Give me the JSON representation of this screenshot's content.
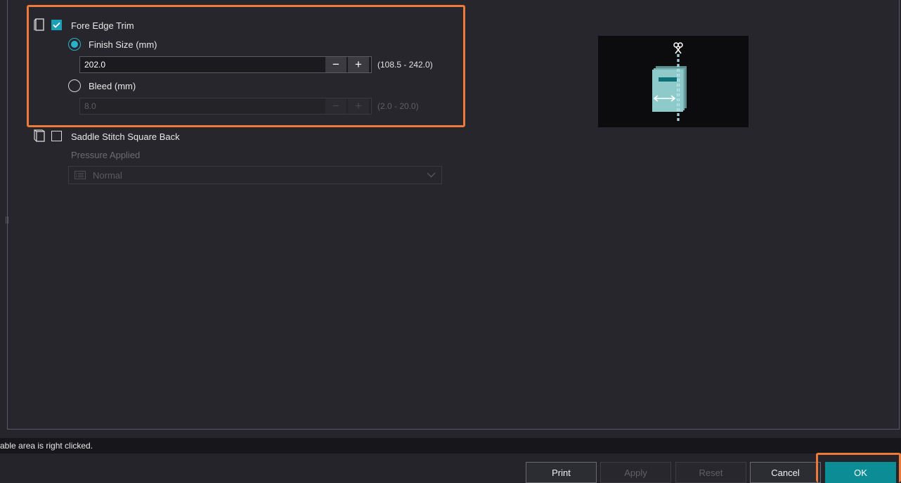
{
  "fore_edge_trim": {
    "label": "Fore Edge Trim",
    "checked": true,
    "finish_size": {
      "label": "Finish Size (mm)",
      "value": "202.0",
      "range": "(108.5 - 242.0)",
      "selected": true
    },
    "bleed": {
      "label": "Bleed (mm)",
      "value": "8.0",
      "range": "(2.0 - 20.0)",
      "selected": false
    }
  },
  "saddle_stitch": {
    "label": "Saddle Stitch Square Back",
    "checked": false,
    "pressure_label": "Pressure Applied",
    "pressure_value": "Normal"
  },
  "status": {
    "text": "able area is right clicked."
  },
  "buttons": {
    "print": "Print",
    "apply": "Apply",
    "reset": "Reset",
    "cancel": "Cancel",
    "ok": "OK"
  },
  "colors": {
    "accent": "#1a9fb6",
    "highlight": "#ee7a3a",
    "ok": "#0c8c94"
  }
}
